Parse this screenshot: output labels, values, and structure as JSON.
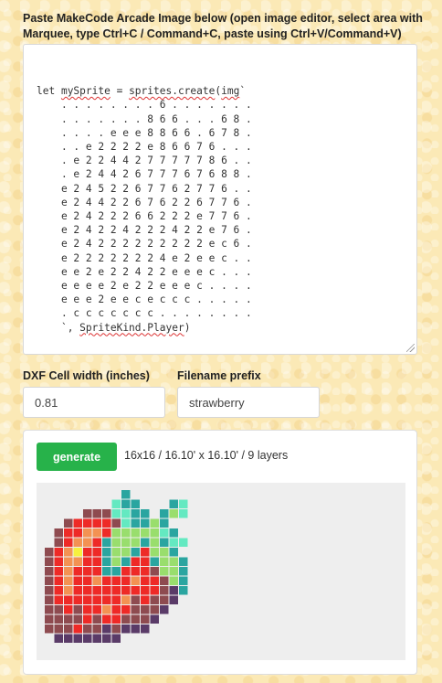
{
  "instructions": "Paste MakeCode Arcade Image below (open image editor, select area with Marquee, type Ctrl+C / Command+C, paste using Ctrl+V/Command+V)",
  "code": {
    "line1_prefix": "let ",
    "line1_var": "mySprite",
    "line1_mid": " = ",
    "line1_call": "sprites.create",
    "line1_paren": "(",
    "line1_img": "img",
    "line1_tick": "`",
    "rows": [
      ". . . . . . . . 6 . . . . . . .",
      ". . . . . . . 8 6 6 . . . 6 8 .",
      ". . . . e e e 8 8 6 6 . 6 7 8 .",
      ". . e 2 2 2 2 e 8 6 6 7 6 . . .",
      ". e 2 2 4 4 2 7 7 7 7 7 8 6 . .",
      ". e 2 4 4 2 6 7 7 7 6 7 6 8 8 .",
      "e 2 4 5 2 2 6 7 7 6 2 7 7 6 . .",
      "e 2 4 4 2 2 6 7 6 2 2 6 7 7 6 .",
      "e 2 4 2 2 2 6 6 2 2 2 e 7 7 6 .",
      "e 2 4 2 2 4 2 2 2 4 2 2 e 7 6 .",
      "e 2 4 2 2 2 2 2 2 2 2 2 e c 6 .",
      "e 2 2 2 2 2 2 2 4 e 2 e e c . .",
      "e e 2 e 2 2 4 2 2 e e e c . . .",
      "e e e e 2 e 2 2 e e e c . . . .",
      "e e e 2 e e c e c c c . . . . .",
      ". c c c c c c c . . . . . . . ."
    ],
    "last_tick": "`, ",
    "last_kind": "SpriteKind.Player",
    "last_close": ")"
  },
  "fields": {
    "cell_width_label": "DXF Cell width (inches)",
    "cell_width_value": "0.81",
    "prefix_label": "Filename prefix",
    "prefix_value": "strawberry"
  },
  "generate_label": "generate",
  "status": "16x16 / 16.10' x 16.10' / 9 layers",
  "palette": {
    "2": "#ee2a27",
    "4": "#f39253",
    "5": "#f6f13e",
    "6": "#2aa5a0",
    "7": "#99de6d",
    "8": "#64e9c1",
    "e": "#8e4b50",
    "c": "#5a3b68"
  },
  "icons": {
    "resize": "resize-grip-icon"
  }
}
